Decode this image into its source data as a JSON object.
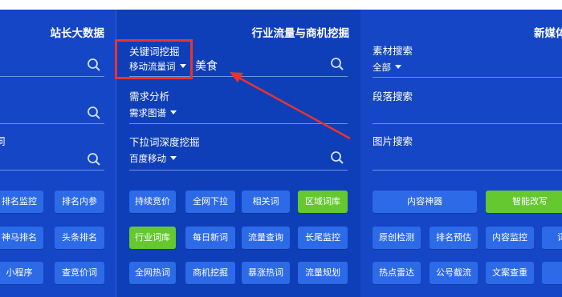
{
  "left": {
    "title": "站长大数据",
    "fragment": "词",
    "buttons": [
      {
        "label": "排名监控"
      },
      {
        "label": "排名内参"
      },
      {
        "label": "神马排名"
      },
      {
        "label": "头条排名"
      },
      {
        "label": "小程序"
      },
      {
        "label": "查竞价词"
      }
    ]
  },
  "middle": {
    "title": "行业流量与商机挖掘",
    "keyword": {
      "label": "关键词挖掘",
      "select": "移动流量词",
      "value": "美食"
    },
    "demand": {
      "label": "需求分析",
      "select": "需求图谱"
    },
    "dropdown": {
      "label": "下拉词深度挖掘",
      "select": "百度移动"
    },
    "buttons": [
      {
        "label": "持续竞价",
        "active": false
      },
      {
        "label": "全网下拉",
        "active": false
      },
      {
        "label": "相关词",
        "active": false
      },
      {
        "label": "区域词库",
        "active": true
      },
      {
        "label": "行业词库",
        "active": true
      },
      {
        "label": "每日新词",
        "active": false
      },
      {
        "label": "流量查询",
        "active": false
      },
      {
        "label": "长尾监控",
        "active": false
      },
      {
        "label": "全网热词",
        "active": false
      },
      {
        "label": "商机挖掘",
        "active": false
      },
      {
        "label": "暴涨热词",
        "active": false
      },
      {
        "label": "流量规划",
        "active": false
      }
    ]
  },
  "right": {
    "title": "新媒体",
    "material": {
      "label": "素材搜索",
      "select": "全部"
    },
    "paragraph": {
      "label": "段落搜索"
    },
    "image": {
      "label": "图片搜索"
    },
    "buttons": [
      {
        "label": "内容神器",
        "active": false
      },
      {
        "label": "智能改写",
        "active": true
      },
      {
        "label": "原创检测",
        "active": false
      },
      {
        "label": "排名预估",
        "active": false
      },
      {
        "label": "内容监控",
        "active": false
      },
      {
        "label": "词云",
        "active": false
      },
      {
        "label": "热点雷达",
        "active": false
      },
      {
        "label": "公号截流",
        "active": false
      },
      {
        "label": "文案查重",
        "active": false
      },
      {
        "label": "词",
        "active": false
      }
    ]
  },
  "colors": {
    "panel": "#1446c6",
    "panel_mid": "#0f3fb8",
    "button": "#2c6ae8",
    "button_active": "#64c82e",
    "highlight": "#e8332f"
  }
}
